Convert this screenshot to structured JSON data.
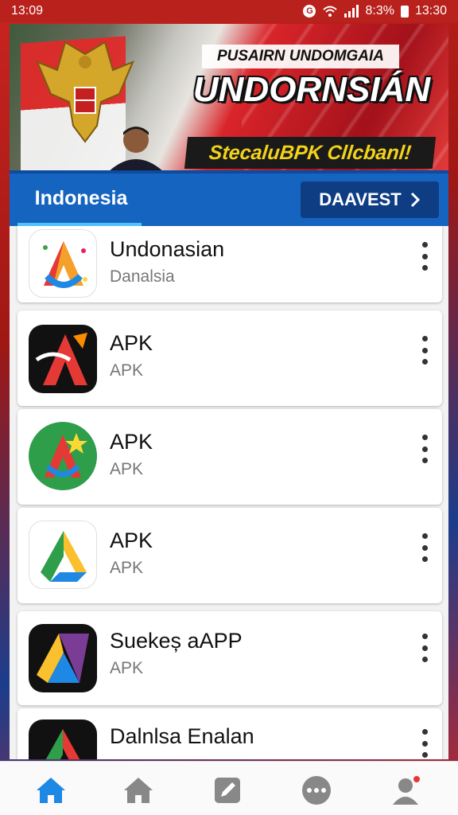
{
  "status_bar": {
    "time": "13:09",
    "battery": "8:3%",
    "clock": "13:30",
    "badge": "G"
  },
  "banner": {
    "line1": "PUSAIRN UNDOMGAIA",
    "line2": "UNDORNSIÁN",
    "line3": "StecaluBPK Cllcbanl!"
  },
  "tabs": {
    "active_label": "Indonesia",
    "action_label": "DAAVEST",
    "action_icon": "chevron-right-icon"
  },
  "apps": [
    {
      "title": "Undonasian",
      "subtitle": "Danalsia",
      "icon": "colorful-a-icon"
    },
    {
      "title": "APK",
      "subtitle": "APK",
      "icon": "red-a-black-icon"
    },
    {
      "title": "APK",
      "subtitle": "APK",
      "icon": "green-circle-a-icon"
    },
    {
      "title": "APK",
      "subtitle": "APK",
      "icon": "drive-triangle-icon"
    },
    {
      "title": "Suekeș aAPP",
      "subtitle": "APK",
      "icon": "drive-black-icon"
    },
    {
      "title": "Dalnlsa Enalan",
      "subtitle": "",
      "icon": "drive-multicolor-icon"
    }
  ],
  "bottom_nav": [
    "home-icon",
    "home-outline-icon",
    "edit-icon",
    "more-icon",
    "profile-icon"
  ],
  "colors": {
    "accent": "#1565c0",
    "active_nav": "#1e88e5",
    "banner_red": "#d9252a"
  }
}
